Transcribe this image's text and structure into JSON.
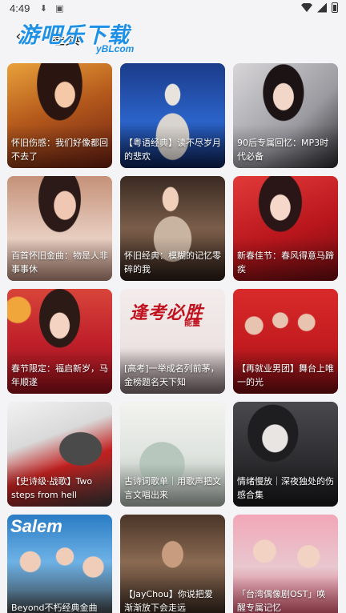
{
  "status_bar": {
    "time": "4:49",
    "icons": [
      "download-icon",
      "a-icon"
    ],
    "right_icons": [
      "wifi-icon",
      "signal-icon",
      "battery-icon"
    ]
  },
  "header": {
    "title": "经典",
    "back_icon": "back-arrow-icon"
  },
  "watermark": {
    "main": "游吧乐下载",
    "sub": "yBLcom"
  },
  "cards": [
    {
      "caption": "怀旧伤感：我们好像都回不去了"
    },
    {
      "caption": "【粤语经典】读不尽岁月的悲欢"
    },
    {
      "caption": "90后专属回忆：MP3时代必备"
    },
    {
      "caption": "百首怀旧金曲：物是人非事事休"
    },
    {
      "caption": "怀旧经典：模糊的记忆零碎的我"
    },
    {
      "caption": "新春佳节：春风得意马蹄疾"
    },
    {
      "caption": "春节限定：福启新岁，马年顺遂"
    },
    {
      "caption": "[高考]一举成名列前茅，金榜题名天下知",
      "poster_title": "逢考必胜",
      "poster_sub": "能量"
    },
    {
      "caption": "【再就业男团】舞台上唯一的光"
    },
    {
      "caption": "【史诗级·战歌】Two steps from hell"
    },
    {
      "caption": "古诗词歌单｜用歌声把文言文唱出来"
    },
    {
      "caption": "情绪慢放｜深夜独处的伤感合集"
    },
    {
      "caption": "Beyond不朽经典金曲",
      "poster_title": "Salem"
    },
    {
      "caption": "【JayChou】你说把爱渐渐放下会走远"
    },
    {
      "caption": "「台湾偶像剧OST」唤醒专属记忆"
    }
  ]
}
